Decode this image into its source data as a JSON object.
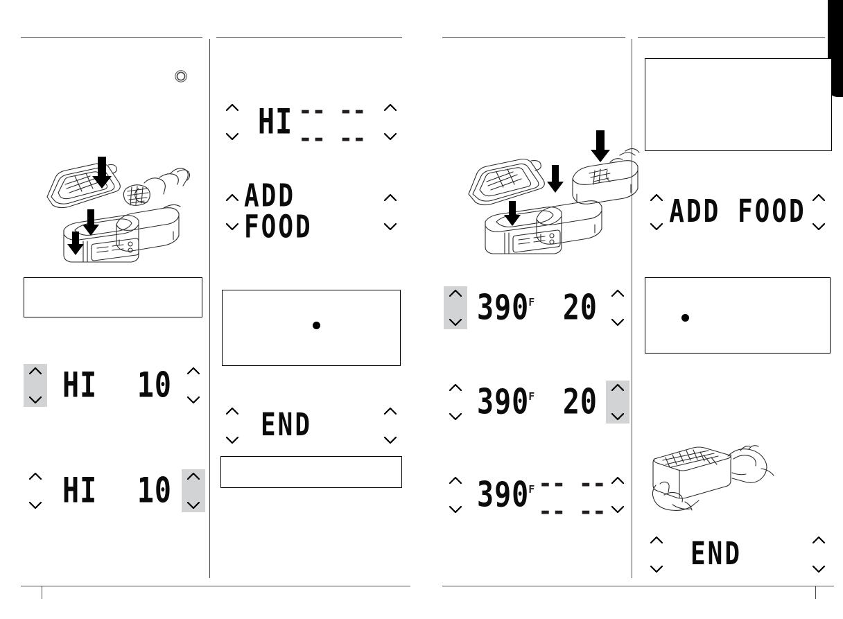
{
  "document": {
    "type": "appliance-instruction-manual-spread",
    "page_count_visible": 2,
    "background_color": "#ffffff",
    "line_color": "#4a4a4a",
    "highlight_color": "#d2d3d4",
    "text_color": "#0b0b0b"
  },
  "left_page": {
    "column_left": {
      "power_icon_label": "power-button-symbol",
      "illustration_label": "open-cooker-with-rack-and-basket-insert",
      "callout_box_empty": "",
      "displays": [
        {
          "id": "hi-10-left-selected",
          "left_text": "HI",
          "right_text": "10",
          "left_arrows_highlighted": true,
          "right_arrows_highlighted": false
        },
        {
          "id": "hi-10-right-selected",
          "left_text": "HI",
          "right_text": "10",
          "left_arrows_highlighted": false,
          "right_arrows_highlighted": true
        }
      ]
    },
    "column_right": {
      "displays": [
        {
          "id": "hi-dashes",
          "left_text": "HI",
          "right_text": "-- -- -- --",
          "left_arrows_highlighted": false,
          "right_arrows_highlighted": false
        },
        {
          "id": "add-food",
          "left_text": "ADD FOOD",
          "right_text": "",
          "left_arrows_highlighted": false,
          "right_arrows_highlighted": false
        },
        {
          "id": "end",
          "left_text": "END",
          "right_text": "",
          "left_arrows_highlighted": false,
          "right_arrows_highlighted": false
        }
      ],
      "callout_box_with_bullet": "",
      "callout_box_empty": ""
    }
  },
  "right_page": {
    "column_left": {
      "illustration_label": "open-cooker-with-stacked-baskets-insert",
      "displays": [
        {
          "id": "390f-20-left-selected",
          "left_text": "390",
          "left_unit": "F",
          "right_text": "20",
          "left_arrows_highlighted": true,
          "right_arrows_highlighted": false
        },
        {
          "id": "390f-20-right-selected",
          "left_text": "390",
          "left_unit": "F",
          "right_text": "20",
          "left_arrows_highlighted": false,
          "right_arrows_highlighted": true
        },
        {
          "id": "390f-dashes",
          "left_text": "390",
          "left_unit": "F",
          "right_text": "-- -- -- --",
          "left_arrows_highlighted": false,
          "right_arrows_highlighted": false
        }
      ]
    },
    "column_right": {
      "callout_box_empty_top": "",
      "displays": [
        {
          "id": "add-food-right",
          "left_text": "ADD FOOD",
          "right_text": "",
          "left_arrows_highlighted": false,
          "right_arrows_highlighted": false
        },
        {
          "id": "end-right",
          "left_text": "END",
          "right_text": "",
          "left_arrows_highlighted": false,
          "right_arrows_highlighted": false
        }
      ],
      "callout_box_with_bullet": "",
      "illustration_label": "hands-lifting-basket-with-fries"
    },
    "page_tab_label": "black-edge-tab"
  }
}
